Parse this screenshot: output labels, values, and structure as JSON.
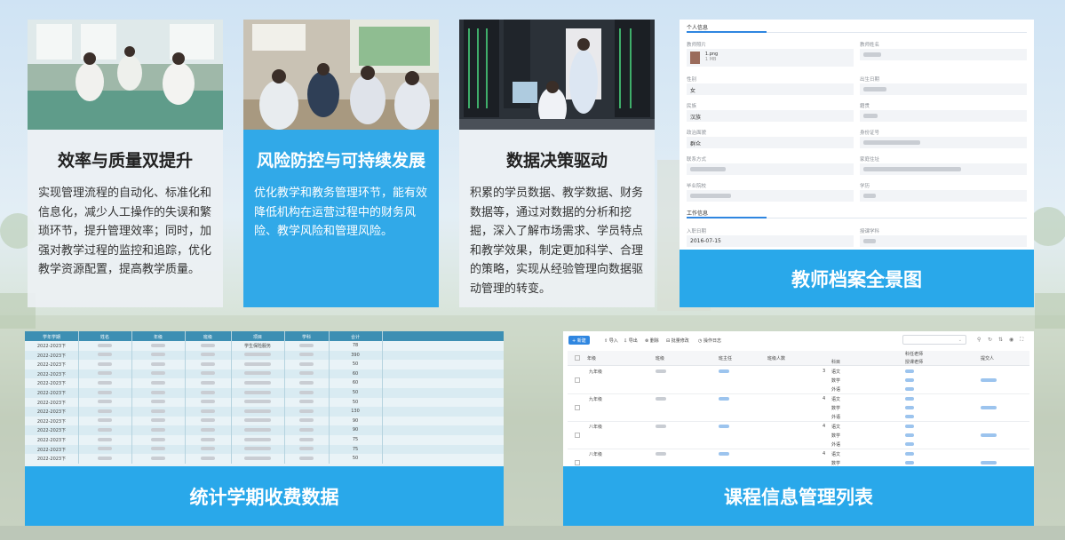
{
  "cards": [
    {
      "title": "效率与质量双提升",
      "body": "实现管理流程的自动化、标准化和信息化，减少人工操作的失误和繁琐环节，提升管理效率；同时，加强对教学过程的监控和追踪，优化教学资源配置，提高教学质量。"
    },
    {
      "title": "风险防控与可持续发展",
      "body": "优化教学和教务管理环节，能有效降低机构在运营过程中的财务风险、教学风险和管理风险。"
    },
    {
      "title": "数据决策驱动",
      "body": "积累的学员数据、教学数据、财务数据等，通过对数据的分析和挖掘，深入了解市场需求、学员特点和教学效果，制定更加科学、合理的策略，实现从经验管理向数据驱动管理的转变。"
    }
  ],
  "banners": {
    "profile": "教师档案全景图",
    "fees": "统计学期收费数据",
    "courses": "课程信息管理列表"
  },
  "profile": {
    "section_personal": "个人信息",
    "section_work": "工作信息",
    "fields": {
      "photo_label": "教师照片",
      "photo_file": "1.png",
      "photo_size": "1 MB",
      "name_label": "教师姓名",
      "gender_label": "性别",
      "gender_value": "女",
      "birth_label": "出生日期",
      "ethnic_label": "民族",
      "ethnic_value": "汉族",
      "native_label": "籍贯",
      "political_label": "政治面貌",
      "political_value": "群众",
      "idcard_label": "身份证号",
      "contact_label": "联系方式",
      "address_label": "家庭住址",
      "school_label": "毕业院校",
      "degree_label": "学历",
      "hire_label": "入职日期",
      "hire_value": "2016-07-15",
      "subject_label": "授课学科"
    }
  },
  "fee_table": {
    "headers": [
      "学年学期",
      "姓名",
      "年级",
      "班级",
      "项目",
      "学科",
      "合计"
    ],
    "rows": [
      [
        "2022-2023下",
        "",
        "",
        "",
        "学生保险服务",
        "",
        "78"
      ],
      [
        "2022-2023下",
        "",
        "",
        "",
        "",
        "",
        "390"
      ],
      [
        "2022-2023下",
        "",
        "",
        "",
        "",
        "",
        "50"
      ],
      [
        "2022-2023下",
        "",
        "",
        "",
        "",
        "",
        "60"
      ],
      [
        "2022-2023下",
        "",
        "",
        "",
        "",
        "",
        "60"
      ],
      [
        "2022-2023下",
        "",
        "",
        "",
        "",
        "",
        "50"
      ],
      [
        "2022-2023下",
        "",
        "",
        "",
        "",
        "",
        "50"
      ],
      [
        "2022-2023下",
        "",
        "",
        "",
        "",
        "",
        "130"
      ],
      [
        "2022-2023下",
        "",
        "",
        "",
        "",
        "",
        "90"
      ],
      [
        "2022-2023下",
        "",
        "",
        "",
        "",
        "",
        "90"
      ],
      [
        "2022-2023下",
        "",
        "",
        "",
        "",
        "",
        "75"
      ],
      [
        "2022-2023下",
        "",
        "",
        "",
        "",
        "",
        "75"
      ],
      [
        "2022-2023下",
        "",
        "",
        "",
        "",
        "",
        "50"
      ]
    ]
  },
  "course_list": {
    "toolbar": [
      "新建",
      "导入",
      "导出",
      "删除",
      "批量修改",
      "操作日志"
    ],
    "search_placeholder": "",
    "headers": [
      "年级",
      "班级",
      "班主任",
      "班级人数",
      "科目",
      "授课老师",
      "提交人"
    ],
    "header_group": "科任老师",
    "groups": [
      {
        "grade": "九年级",
        "count": "3",
        "subjects": [
          "语文",
          "数学",
          "外语"
        ]
      },
      {
        "grade": "九年级",
        "count": "4",
        "subjects": [
          "语文",
          "数学",
          "外语"
        ]
      },
      {
        "grade": "八年级",
        "count": "4",
        "subjects": [
          "语文",
          "数学",
          "外语"
        ]
      },
      {
        "grade": "八年级",
        "count": "4",
        "subjects": [
          "语文",
          "数学",
          "外语"
        ]
      }
    ]
  },
  "colors": {
    "accent": "#29a8ea",
    "active_card": "#31a9e8",
    "table_header": "#3d8fb3",
    "link": "#2f86e0"
  }
}
